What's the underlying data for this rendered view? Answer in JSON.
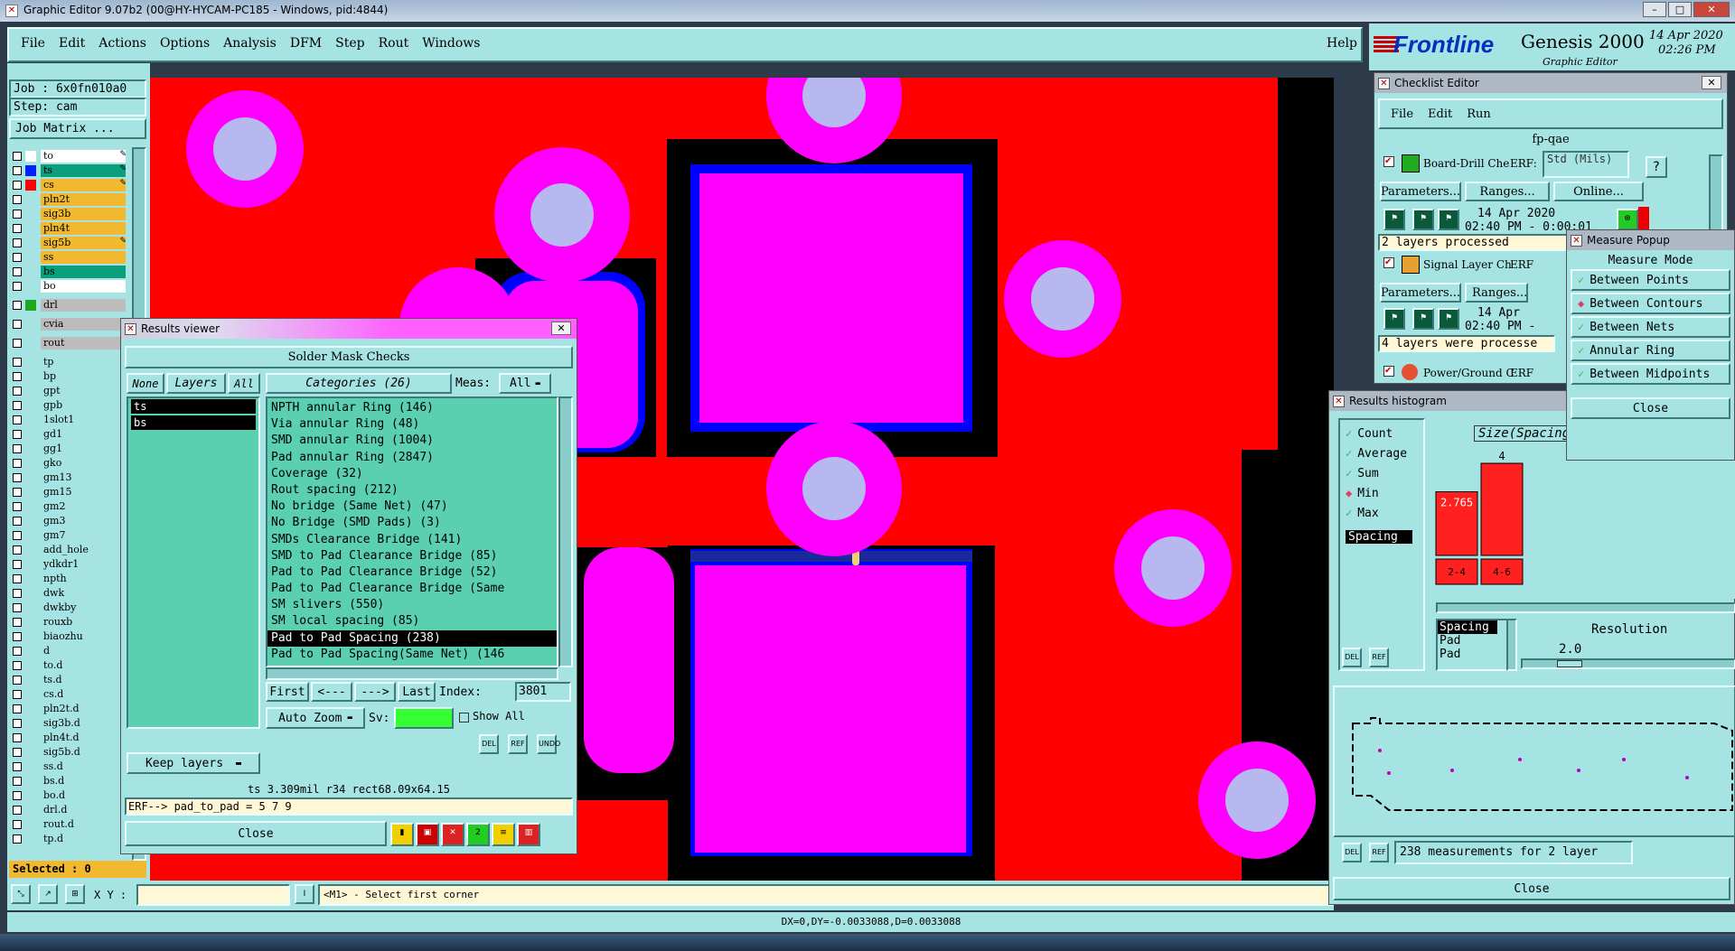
{
  "app": {
    "title": "Graphic Editor 9.07b2 (00@HY-HYCAM-PC185 - Windows, pid:4844)",
    "menus": [
      "File",
      "Edit",
      "Actions",
      "Options",
      "Analysis",
      "DFM",
      "Step",
      "Rout",
      "Windows"
    ],
    "help": "Help",
    "brand": "Frontline",
    "product": "Genesis 2000",
    "product_sub": "Graphic Editor",
    "date": "14 Apr 2020",
    "time": "02:26 PM"
  },
  "job": {
    "job_label": "Job : 6x0fn010a0",
    "step_label": "Step: cam",
    "matrix_button": "Job Matrix ..."
  },
  "layers": [
    {
      "name": "to",
      "sw": "#fff",
      "bg": "#ffffff",
      "ed": "✎"
    },
    {
      "name": "ts",
      "sw": "#0020ff",
      "bg": "#0b9e7a",
      "ed": "✎"
    },
    {
      "name": "cs",
      "sw": "#ff0000",
      "bg": "#f2b830",
      "ed": "✎"
    },
    {
      "name": "pln2t",
      "sw": "",
      "bg": "#f2b830",
      "ed": ""
    },
    {
      "name": "sig3b",
      "sw": "",
      "bg": "#f2b830",
      "ed": ""
    },
    {
      "name": "pln4t",
      "sw": "",
      "bg": "#f2b830",
      "ed": ""
    },
    {
      "name": "sig5b",
      "sw": "",
      "bg": "#f2b830",
      "ed": "✎"
    },
    {
      "name": "ss",
      "sw": "",
      "bg": "#f2b830",
      "ed": ""
    },
    {
      "name": "bs",
      "sw": "",
      "bg": "#0b9e7a",
      "ed": ""
    },
    {
      "name": "bo",
      "sw": "",
      "bg": "#ffffff",
      "ed": ""
    },
    {
      "name": "drl",
      "sw": "#1fa81f",
      "bg": "#bcbcbc",
      "ed": "",
      "gap": true
    },
    {
      "name": "cvia",
      "sw": "",
      "bg": "#bcbcbc",
      "ed": "",
      "gap": true
    },
    {
      "name": "rout",
      "sw": "",
      "bg": "#bcbcbc",
      "ed": "",
      "gap": true
    },
    {
      "name": "tp",
      "sw": "",
      "bg": "#a6e3e3",
      "ed": "",
      "gap": true
    },
    {
      "name": "bp",
      "sw": "",
      "bg": "#a6e3e3",
      "ed": ""
    },
    {
      "name": "gpt",
      "sw": "",
      "bg": "#a6e3e3",
      "ed": ""
    },
    {
      "name": "gpb",
      "sw": "",
      "bg": "#a6e3e3",
      "ed": ""
    },
    {
      "name": "1slot1",
      "sw": "",
      "bg": "#a6e3e3",
      "ed": ""
    },
    {
      "name": "gd1",
      "sw": "",
      "bg": "#a6e3e3",
      "ed": "✎"
    },
    {
      "name": "gg1",
      "sw": "",
      "bg": "#a6e3e3",
      "ed": ""
    },
    {
      "name": "gko",
      "sw": "",
      "bg": "#a6e3e3",
      "ed": ""
    },
    {
      "name": "gm13",
      "sw": "",
      "bg": "#a6e3e3",
      "ed": ""
    },
    {
      "name": "gm15",
      "sw": "",
      "bg": "#a6e3e3",
      "ed": ""
    },
    {
      "name": "gm2",
      "sw": "",
      "bg": "#a6e3e3",
      "ed": ""
    },
    {
      "name": "gm3",
      "sw": "",
      "bg": "#a6e3e3",
      "ed": "✎"
    },
    {
      "name": "gm7",
      "sw": "",
      "bg": "#a6e3e3",
      "ed": ""
    },
    {
      "name": "add_hole",
      "sw": "",
      "bg": "#a6e3e3",
      "ed": ""
    },
    {
      "name": "ydkdr1",
      "sw": "",
      "bg": "#a6e3e3",
      "ed": ""
    },
    {
      "name": "npth",
      "sw": "",
      "bg": "#a6e3e3",
      "ed": ""
    },
    {
      "name": "dwk",
      "sw": "",
      "bg": "#a6e3e3",
      "ed": ""
    },
    {
      "name": "dwkby",
      "sw": "",
      "bg": "#a6e3e3",
      "ed": ""
    },
    {
      "name": "rouxb",
      "sw": "",
      "bg": "#a6e3e3",
      "ed": ""
    },
    {
      "name": "biaozhu",
      "sw": "",
      "bg": "#a6e3e3",
      "ed": ""
    },
    {
      "name": "d",
      "sw": "",
      "bg": "#a6e3e3",
      "ed": ""
    },
    {
      "name": "to.d",
      "sw": "",
      "bg": "#a6e3e3",
      "ed": "✎"
    },
    {
      "name": "ts.d",
      "sw": "",
      "bg": "#a6e3e3",
      "ed": ""
    },
    {
      "name": "cs.d",
      "sw": "",
      "bg": "#a6e3e3",
      "ed": "✎"
    },
    {
      "name": "pln2t.d",
      "sw": "",
      "bg": "#a6e3e3",
      "ed": ""
    },
    {
      "name": "sig3b.d",
      "sw": "",
      "bg": "#a6e3e3",
      "ed": ""
    },
    {
      "name": "pln4t.d",
      "sw": "",
      "bg": "#a6e3e3",
      "ed": ""
    },
    {
      "name": "sig5b.d",
      "sw": "",
      "bg": "#a6e3e3",
      "ed": "✎"
    },
    {
      "name": "ss.d",
      "sw": "",
      "bg": "#a6e3e3",
      "ed": ""
    },
    {
      "name": "bs.d",
      "sw": "",
      "bg": "#a6e3e3",
      "ed": ""
    },
    {
      "name": "bo.d",
      "sw": "",
      "bg": "#a6e3e3",
      "ed": ""
    },
    {
      "name": "drl.d",
      "sw": "",
      "bg": "#a6e3e3",
      "ed": ""
    },
    {
      "name": "rout.d",
      "sw": "",
      "bg": "#a6e3e3",
      "ed": ""
    },
    {
      "name": "tp.d",
      "sw": "",
      "bg": "#a6e3e3",
      "ed": ""
    }
  ],
  "selected_label": "Selected : 0",
  "bottom": {
    "xy_label": "X Y :",
    "prompt": "<M1> - Select first corner",
    "coords": "DX=0,DY=-0.0033088,D=0.0033088"
  },
  "results_viewer": {
    "title": "Results viewer",
    "header": "Solder Mask Checks",
    "none": "None",
    "layers_label": "Layers",
    "all": "All",
    "layer_items": [
      "ts",
      "bs"
    ],
    "categories_label": "Categories (26)",
    "meas_label": "Meas:",
    "meas_value": "All",
    "categories": [
      "NPTH annular Ring (146)",
      "Via annular Ring (48)",
      "SMD annular Ring (1004)",
      "Pad annular Ring (2847)",
      "Coverage (32)",
      "Rout spacing (212)",
      "No bridge (Same Net) (47)",
      "No Bridge (SMD Pads) (3)",
      "SMDs Clearance Bridge (141)",
      "SMD to Pad Clearance Bridge (85)",
      "Pad to Pad Clearance Bridge (52)",
      "Pad to Pad Clearance Bridge (Same",
      "SM slivers (550)",
      "SM local spacing (85)",
      "Pad to Pad Spacing (238)",
      "Pad to Pad Spacing(Same Net) (146"
    ],
    "selected_index": 14,
    "first": "First",
    "prev": "<---",
    "next": "--->",
    "last": "Last",
    "index_label": "Index:",
    "index_value": "3801",
    "auto_zoom": "Auto Zoom",
    "sv_label": "Sv:",
    "show_all": "Show All",
    "keep_layers": "Keep layers",
    "del": "DEL",
    "ref": "REF",
    "undo": "UNDO",
    "status1": "ts 3.309mil  r34  rect68.09x64.15",
    "status2": "ERF--> pad_to_pad = 5 7 9",
    "close": "Close"
  },
  "checklist": {
    "title": "Checklist Editor",
    "menus": [
      "File",
      "Edit",
      "Run"
    ],
    "name": "fp-qae",
    "items": [
      {
        "label": "Board-Drill Che",
        "erf": "ERF:",
        "std": "Std (Mils)",
        "date": "14 Apr 2020",
        "time": "02:40 PM - 0:00:01",
        "status": "2 layers processed"
      },
      {
        "label": "Signal Layer Ch",
        "erf": "ERF",
        "date": "14 Apr",
        "time": "02:40 PM -",
        "status": "4 layers were processe"
      },
      {
        "label": "Power/Ground C",
        "erf": "ERF"
      }
    ],
    "params": "Parameters...",
    "ranges": "Ranges...",
    "online": "Online..."
  },
  "measure": {
    "title": "Measure Popup",
    "mode_label": "Measure Mode",
    "modes": [
      "Between Points",
      "Between Contours",
      "Between Nets",
      "Annular Ring",
      "Between Midpoints"
    ],
    "selected_mode": 1,
    "close": "Close"
  },
  "histogram": {
    "title": "Results histogram",
    "options": [
      "Count",
      "Average",
      "Sum",
      "Min",
      "Max"
    ],
    "selected_option": 3,
    "spacing": "Spacing",
    "chart_title": "Size(Spacing",
    "bar_labels": [
      "2.765",
      "4"
    ],
    "bins": [
      "2-4",
      "4-6"
    ],
    "list": [
      "Spacing",
      "Pad",
      "Pad"
    ],
    "resolution_label": "Resolution",
    "resolution_value": "2.0",
    "measurements": "238 measurements for 2 layer",
    "close": "Close"
  },
  "chart_data": {
    "type": "bar",
    "title": "Size(Spacing",
    "categories": [
      "2-4",
      "4-6"
    ],
    "values": [
      2.765,
      4
    ]
  },
  "colors": {
    "panel": "#a6e3e3",
    "canvas": "#ff0000",
    "mask": "#ff00ff",
    "drill": "#b8b8f0",
    "copper": "#0000ff"
  }
}
